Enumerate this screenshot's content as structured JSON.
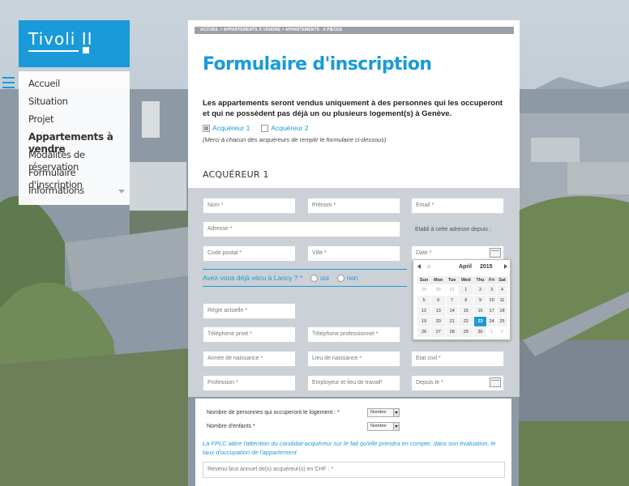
{
  "logo": {
    "text": "Tivoli II"
  },
  "nav": {
    "items": [
      {
        "label": "Accueil"
      },
      {
        "label": "Situation"
      },
      {
        "label": "Projet"
      },
      {
        "label": "Appartements à vendre"
      },
      {
        "label": "Modalités de réservation"
      },
      {
        "label": "Formulaire d'inscription"
      },
      {
        "label": "Informations"
      }
    ]
  },
  "breadcrumb": "ACCUEIL > APPARTEMENTS À VENDRE > APPARTEMENTS - 6 PIÈCES",
  "page_title": "Formulaire d'inscription",
  "intro": "Les appartements seront vendus uniquement à des personnes qui les occuperont et qui ne possèdent pas déjà un ou plusieurs logement(s) à Genève.",
  "buyers": {
    "buyer1": "Acquéreur 1",
    "buyer2": "Acquéreur 2"
  },
  "hint": "(Merci à chacun des acquéreurs de remplir le formulaire ci-dessous)",
  "section_title": "ACQUÉREUR 1",
  "fields": {
    "nom": "Nom *",
    "prenom": "Prénom *",
    "email": "Email *",
    "adresse": "Adresse *",
    "etabli": "Etabli à cette adresse depuis :",
    "code_postal": "Code postal *",
    "ville": "Ville *",
    "date": "Date *",
    "question": "Avez-vous déjà vécu à Lancy ? *",
    "oui": "oui",
    "non": "non",
    "regie": "Régie actuelle *",
    "tel_prive": "Téléphone privé *",
    "tel_pro": "Téléphone professionnel *",
    "annee_naissance": "Année de naissance *",
    "lieu_naissance": "Lieu de naissance *",
    "etat_civil": "Etat civil *",
    "profession": "Profession *",
    "employeur": "Employeur et lieu de travail*",
    "depuis": "Depuis le *"
  },
  "datepicker": {
    "month": "April",
    "year": "2015",
    "weekdays": [
      "Sun",
      "Mon",
      "Tue",
      "Wed",
      "Thu",
      "Fri",
      "Sat"
    ],
    "weeks": [
      [
        "29",
        "30",
        "31",
        "1",
        "2",
        "3",
        "4"
      ],
      [
        "5",
        "6",
        "7",
        "8",
        "9",
        "10",
        "11"
      ],
      [
        "12",
        "13",
        "14",
        "15",
        "16",
        "17",
        "18"
      ],
      [
        "19",
        "20",
        "21",
        "22",
        "23",
        "24",
        "25"
      ],
      [
        "26",
        "27",
        "28",
        "29",
        "30",
        "1",
        "2"
      ]
    ],
    "selected": "23"
  },
  "lower": {
    "persons_label": "Nombre de personnes qui occuperont le logement : *",
    "children_label": "Nombre d'enfants *",
    "select_value": "Nombre",
    "note": "La FPLC attire l'attention du candidat-acquéreur sur le fait qu'elle prendra en compte, dans son évaluation, le taux d'occupation de l'appartement",
    "revenu": "Revenu brut annuel de(s) acquéreur(s) en CHF : *"
  },
  "colors": {
    "accent": "#1a9ad8"
  }
}
